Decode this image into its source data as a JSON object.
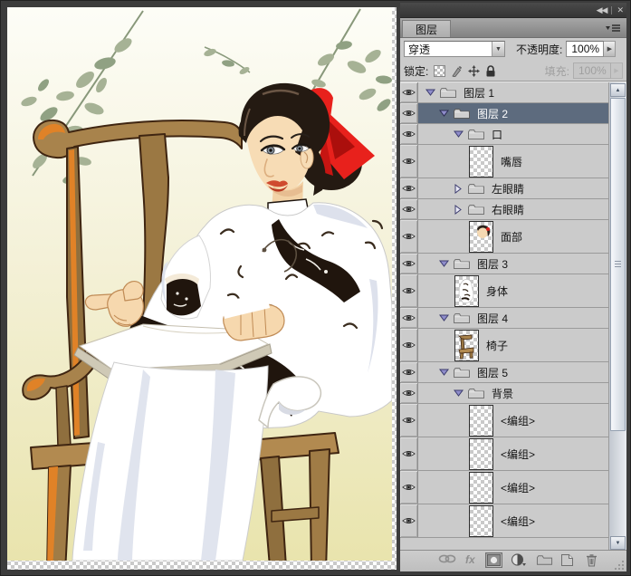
{
  "window": {
    "collapse_glyph": "◀◀",
    "close_glyph": "✕"
  },
  "panel": {
    "tab_label": "图层",
    "blend_mode": "穿透",
    "opacity_label": "不透明度:",
    "opacity_value": "100%",
    "lock_label": "锁定:",
    "fill_label": "填充:",
    "fill_value": "100%",
    "toolbar_fx_label": "fx",
    "layers": [
      {
        "label": "图层 1",
        "type": "group",
        "state": "expanded",
        "depth": 0,
        "selected": false
      },
      {
        "label": "图层 2",
        "type": "group",
        "state": "expanded",
        "depth": 1,
        "selected": true
      },
      {
        "label": "口",
        "type": "group",
        "state": "expanded",
        "depth": 2,
        "selected": false
      },
      {
        "label": "嘴唇",
        "type": "layer",
        "thumbnail": "transparent-checker",
        "depth": 3,
        "selected": false
      },
      {
        "label": "左眼睛",
        "type": "group",
        "state": "collapsed",
        "depth": 2,
        "selected": false
      },
      {
        "label": "右眼睛",
        "type": "group",
        "state": "collapsed",
        "depth": 2,
        "selected": false
      },
      {
        "label": "面部",
        "type": "layer",
        "thumbnail": "face-art",
        "depth": 3,
        "selected": false
      },
      {
        "label": "图层 3",
        "type": "group",
        "state": "expanded",
        "depth": 1,
        "selected": false
      },
      {
        "label": "身体",
        "type": "layer",
        "thumbnail": "body-art",
        "depth": 2,
        "selected": false
      },
      {
        "label": "图层 4",
        "type": "group",
        "state": "expanded",
        "depth": 1,
        "selected": false
      },
      {
        "label": "椅子",
        "type": "layer",
        "thumbnail": "chair-art",
        "depth": 2,
        "selected": false
      },
      {
        "label": "图层 5",
        "type": "group",
        "state": "expanded",
        "depth": 1,
        "selected": false
      },
      {
        "label": "背景",
        "type": "group",
        "state": "expanded",
        "depth": 2,
        "selected": false
      },
      {
        "label": "<编组>",
        "type": "layer",
        "thumbnail": "transparent-checker",
        "depth": 3,
        "selected": false
      },
      {
        "label": "<编组>",
        "type": "layer",
        "thumbnail": "transparent-checker",
        "depth": 3,
        "selected": false
      },
      {
        "label": "<编组>",
        "type": "layer",
        "thumbnail": "transparent-checker",
        "depth": 3,
        "selected": false
      },
      {
        "label": "<编组>",
        "type": "layer",
        "thumbnail": "transparent-checker",
        "depth": 3,
        "selected": false
      }
    ]
  },
  "colors": {
    "selected_row": "#5d6b7e",
    "panel_gray": "#cbcbcb",
    "bow_red": "#e8211c",
    "chair_brown": "#a8834c",
    "chair_accent_orange": "#e08227",
    "leaf_green": "#a6b295",
    "canvas_background_bottom": "#e9e4ad"
  }
}
